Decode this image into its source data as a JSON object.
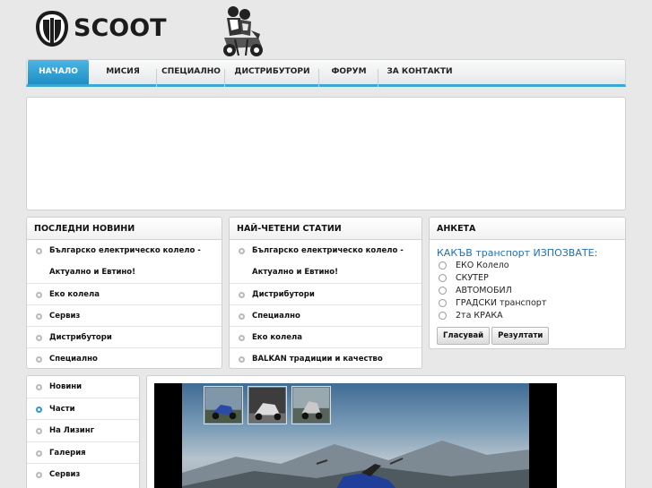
{
  "brand": {
    "name": "SCOOT"
  },
  "nav": {
    "tabs": [
      {
        "label": "НАЧАЛО",
        "active": true
      },
      {
        "label": "МИСИЯ",
        "active": false
      },
      {
        "label": "СПЕЦИАЛНО",
        "active": false
      },
      {
        "label": "ДИСТРИБУТОРИ",
        "active": false
      },
      {
        "label": "ФОРУМ",
        "active": false
      },
      {
        "label": "ЗА КОНТАКТИ",
        "active": false
      }
    ]
  },
  "latest_news": {
    "title": "ПОСЛЕДНИ НОВИНИ",
    "items": [
      "Българско електрическо колело - Актуално и Евтино!",
      "Еко колела",
      "Сервиз",
      "Дистрибутори",
      "Специално"
    ]
  },
  "most_read": {
    "title": "НАЙ-ЧЕТЕНИ СТАТИИ",
    "items": [
      "Българско електрическо колело - Актуално и Евтино!",
      "Дистрибутори",
      "Специално",
      "Еко колела",
      "BALKAN традиции и качество"
    ]
  },
  "poll": {
    "title": "АНКЕТА",
    "question": "КАКЪВ транспорт ИЗПОЗВАТЕ:",
    "options": [
      "ЕКО Колело",
      "СКУТЕР",
      "АВТОМОБИЛ",
      "ГРАДСКИ транспорт",
      "2та КРАКА"
    ],
    "vote_label": "Гласувай",
    "results_label": "Резултати"
  },
  "side_menu": {
    "items": [
      {
        "label": "Новини",
        "active": false
      },
      {
        "label": "Части",
        "active": true
      },
      {
        "label": "На Лизинг",
        "active": false
      },
      {
        "label": "Галерия",
        "active": false
      },
      {
        "label": "Сервиз",
        "active": false
      }
    ]
  },
  "colors": {
    "accent": "#2d9ad2",
    "poll_question": "#1d6fb7"
  },
  "icons": {
    "brand_emblem": "scooter-helmet-emblem-icon",
    "mascot": "scooter-riders-mascot-icon"
  }
}
